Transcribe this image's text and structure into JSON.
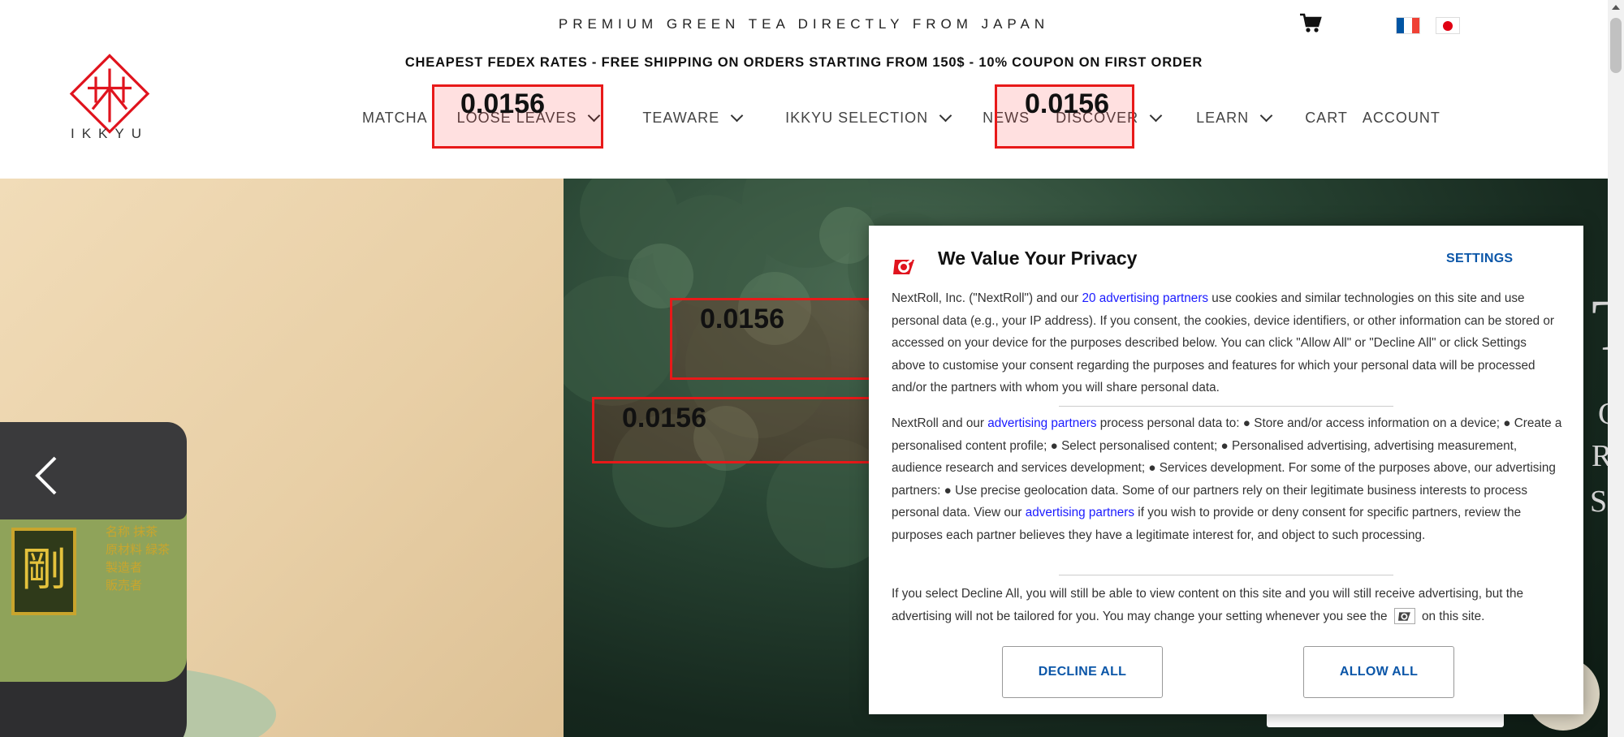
{
  "header": {
    "tagline": "PREMIUM GREEN TEA DIRECTLY FROM JAPAN",
    "shipping_banner": "CHEAPEST FEDEX RATES - FREE SHIPPING ON ORDERS STARTING FROM 150$ - 10% COUPON ON FIRST ORDER",
    "logo_text": "IKKYU",
    "cart_icon": "shopping-cart-icon",
    "flags": [
      "flag-france-icon",
      "flag-japan-icon"
    ]
  },
  "nav": {
    "items": [
      {
        "label": "MATCHA"
      },
      {
        "label": "LOOSE LEAVES"
      },
      {
        "label": "TEAWARE"
      },
      {
        "label": "IKKYU SELECTION"
      },
      {
        "label": "NEWS"
      },
      {
        "label": "DISCOVER"
      },
      {
        "label": "LEARN"
      },
      {
        "label": "CART"
      },
      {
        "label": "ACCOUNT"
      }
    ]
  },
  "annotations": {
    "box_label": "0.0156"
  },
  "hero": {
    "product_label_char": "剛",
    "product_kanji": "名称 抹茶\n原材料 緑茶\n製造者\n販売者",
    "prev_arrow_icon": "chevron-left-icon",
    "edge_text": [
      "T",
      "C",
      "R",
      "S"
    ]
  },
  "consent": {
    "title": "We Value Your Privacy",
    "settings_label": "SETTINGS",
    "p1_before": "NextRoll, Inc. (\"NextRoll\") and our ",
    "p1_link": "20 advertising partners",
    "p1_after": " use cookies and similar technologies on this site and use personal data (e.g., your IP address). If you consent, the cookies, device identifiers, or other information can be stored or accessed on your device for the purposes described below. You can click \"Allow All\" or \"Decline All\" or click Settings above to customise your consent regarding the purposes and features for which your personal data will be processed and/or the partners with whom you will share personal data.",
    "p2_before": "NextRoll and our ",
    "p2_link1": "advertising partners",
    "p2_mid": " process personal data to: ● Store and/or access information on a device; ● Create a personalised content profile; ● Select personalised content; ● Personalised advertising, advertising measurement, audience research and services development; ● Services development. For some of the purposes above, our advertising partners: ● Use precise geolocation data. Some of our partners rely on their legitimate business interests to process personal data. View our ",
    "p2_link2": "advertising partners",
    "p2_after": " if you wish to provide or deny consent for specific partners, review the purposes each partner believes they have a legitimate interest for, and object to such processing.",
    "p3_before": "If you select Decline All, you will still be able to view content on this site and you will still receive advertising, but the advertising will not be tailored for you. You may change your setting whenever you see the ",
    "p3_after": " on this site.",
    "decline_label": "DECLINE ALL",
    "allow_label": "ALLOW ALL",
    "logo_icon": "nextroll-logo-icon"
  },
  "colors": {
    "brand_red": "#e0141e",
    "link_blue": "#1a1aff",
    "button_blue": "#0b56a8",
    "annotation_red": "#e81919"
  }
}
